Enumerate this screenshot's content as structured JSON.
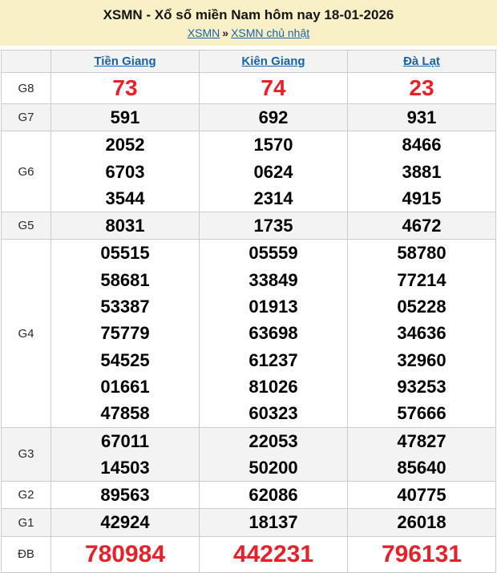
{
  "header": {
    "title": "XSMN - Xổ số miền Nam hôm nay 18-01-2026",
    "breadcrumb": {
      "link1": "XSMN",
      "separator": "»",
      "link2": "XSMN chủ nhật"
    }
  },
  "table": {
    "columns": [
      "Tiền Giang",
      "Kiên Giang",
      "Đà Lạt"
    ],
    "rows": [
      {
        "label": "G8",
        "type": "red",
        "cells": [
          [
            "73"
          ],
          [
            "74"
          ],
          [
            "23"
          ]
        ]
      },
      {
        "label": "G7",
        "type": "normal",
        "cells": [
          [
            "591"
          ],
          [
            "692"
          ],
          [
            "931"
          ]
        ]
      },
      {
        "label": "G6",
        "type": "normal",
        "cells": [
          [
            "2052",
            "6703",
            "3544"
          ],
          [
            "1570",
            "0624",
            "2314"
          ],
          [
            "8466",
            "3881",
            "4915"
          ]
        ]
      },
      {
        "label": "G5",
        "type": "normal",
        "cells": [
          [
            "8031"
          ],
          [
            "1735"
          ],
          [
            "4672"
          ]
        ]
      },
      {
        "label": "G4",
        "type": "normal",
        "cells": [
          [
            "05515",
            "58681",
            "53387",
            "75779",
            "54525",
            "01661",
            "47858"
          ],
          [
            "05559",
            "33849",
            "01913",
            "63698",
            "61237",
            "81026",
            "60323"
          ],
          [
            "58780",
            "77214",
            "05228",
            "34636",
            "32960",
            "93253",
            "57666"
          ]
        ]
      },
      {
        "label": "G3",
        "type": "normal",
        "cells": [
          [
            "67011",
            "14503"
          ],
          [
            "22053",
            "50200"
          ],
          [
            "47827",
            "85640"
          ]
        ]
      },
      {
        "label": "G2",
        "type": "normal",
        "cells": [
          [
            "89563"
          ],
          [
            "62086"
          ],
          [
            "40775"
          ]
        ]
      },
      {
        "label": "G1",
        "type": "normal",
        "cells": [
          [
            "42924"
          ],
          [
            "18137"
          ],
          [
            "26018"
          ]
        ]
      },
      {
        "label": "ĐB",
        "type": "red-large",
        "cells": [
          [
            "780984"
          ],
          [
            "442231"
          ],
          [
            "796131"
          ]
        ]
      }
    ]
  },
  "colors": {
    "accent_red": "#e62129",
    "link_blue": "#1763a8",
    "banner_bg": "#faf0c8",
    "alt_row_bg": "#f3f3f3",
    "border": "#cccccc"
  }
}
